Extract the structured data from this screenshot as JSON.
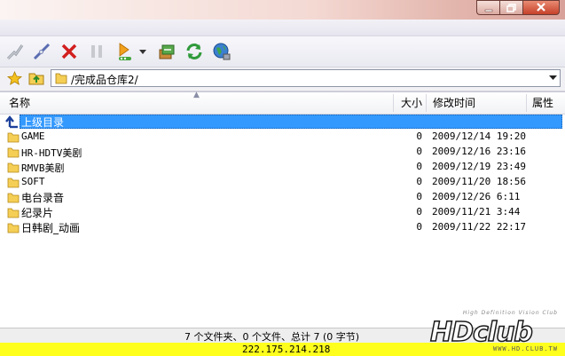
{
  "address": {
    "path": "/完成品仓库2/"
  },
  "columns": {
    "name": "名称",
    "size": "大小",
    "modified": "修改时间",
    "attributes": "属性"
  },
  "rows": [
    {
      "name": "上级目录",
      "size": "",
      "time": "",
      "icon": "parent-directory-arrow-icon",
      "selected": true
    },
    {
      "name": "GAME",
      "size": "0",
      "time": "2009/12/14 19:20",
      "icon": "folder-icon"
    },
    {
      "name": "HR-HDTV美剧",
      "size": "0",
      "time": "2009/12/16 23:16",
      "icon": "folder-icon"
    },
    {
      "name": "RMVB美剧",
      "size": "0",
      "time": "2009/12/19 23:49",
      "icon": "folder-icon"
    },
    {
      "name": "SOFT",
      "size": "0",
      "time": "2009/11/20 18:56",
      "icon": "folder-icon"
    },
    {
      "name": "电台录音",
      "size": "0",
      "time": "2009/12/26 6:11",
      "icon": "folder-icon"
    },
    {
      "name": "纪录片",
      "size": "0",
      "time": "2009/11/21 3:44",
      "icon": "folder-icon"
    },
    {
      "name": "日韩剧_动画",
      "size": "0",
      "time": "2009/11/22 22:17",
      "icon": "folder-icon"
    }
  ],
  "status": {
    "summary": "7 个文件夹、0 个文件、总计 7 (0 字节)",
    "server_ip": "222.175.214.218"
  },
  "watermark": {
    "tagline": "High Definition Vision Club",
    "logo": "HDclub",
    "url": "WWW.HD.CLUB.TW"
  },
  "toolbar_icons": [
    "connect-icon",
    "disconnect-icon",
    "cancel-icon",
    "pause-icon",
    "play-queue-icon",
    "queue-dropdown-icon",
    "transfer-icon",
    "refresh-icon",
    "globe-icon"
  ],
  "colors": {
    "selection": "#3399ff",
    "ip_bar": "#ffff1e",
    "close_button": "#c6412a"
  }
}
